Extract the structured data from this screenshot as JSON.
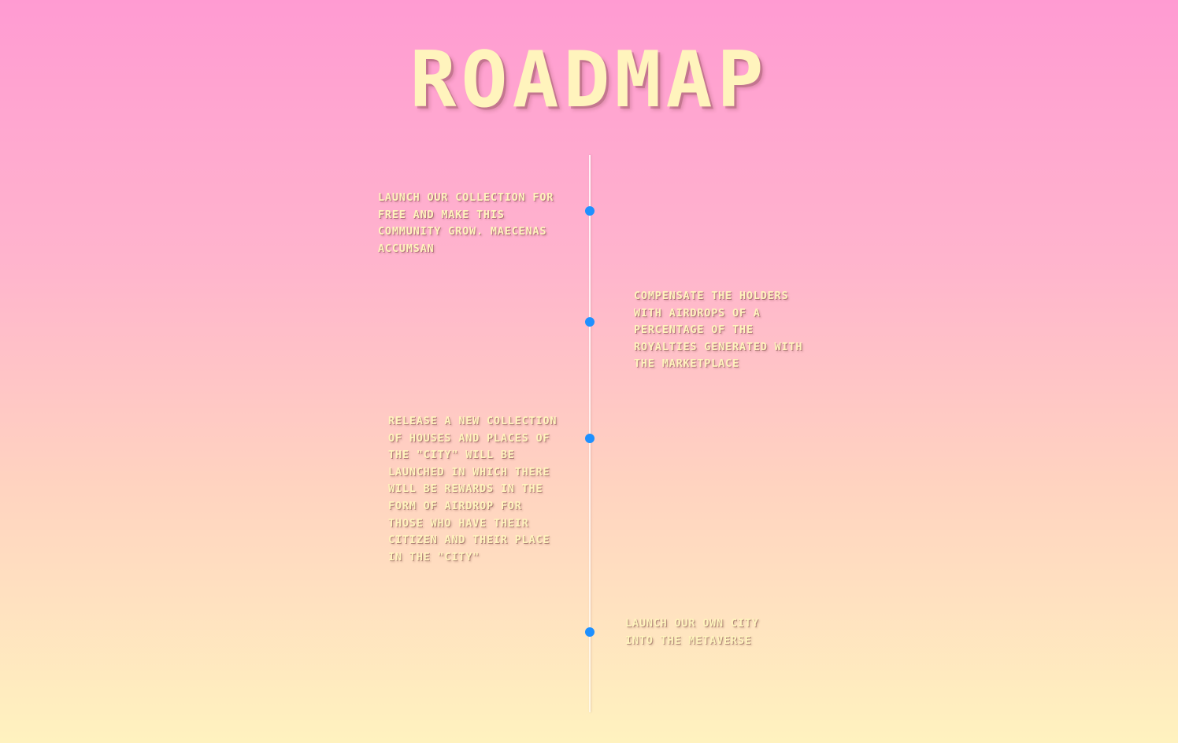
{
  "section": {
    "title": "ROADMAP"
  },
  "milestones": [
    {
      "text": "Launch our collection for free and make this community grow. Maecenas accumsan"
    },
    {
      "text": "Compensate the holders with airdrops of a percentage of the royalties generated with the marketplace"
    },
    {
      "text": "Release a new collection of houses and places of the \"city\" will be launched in which there will be rewards in the form of airdrop for those who have their citizen and their place in the \"city\""
    },
    {
      "text": "Launch our own city into the metaverse"
    }
  ],
  "colors": {
    "background_top": "#ff9bd2",
    "background_bottom": "#fff2bf",
    "text": "#fff4bd",
    "dot": "#1e90ff"
  }
}
